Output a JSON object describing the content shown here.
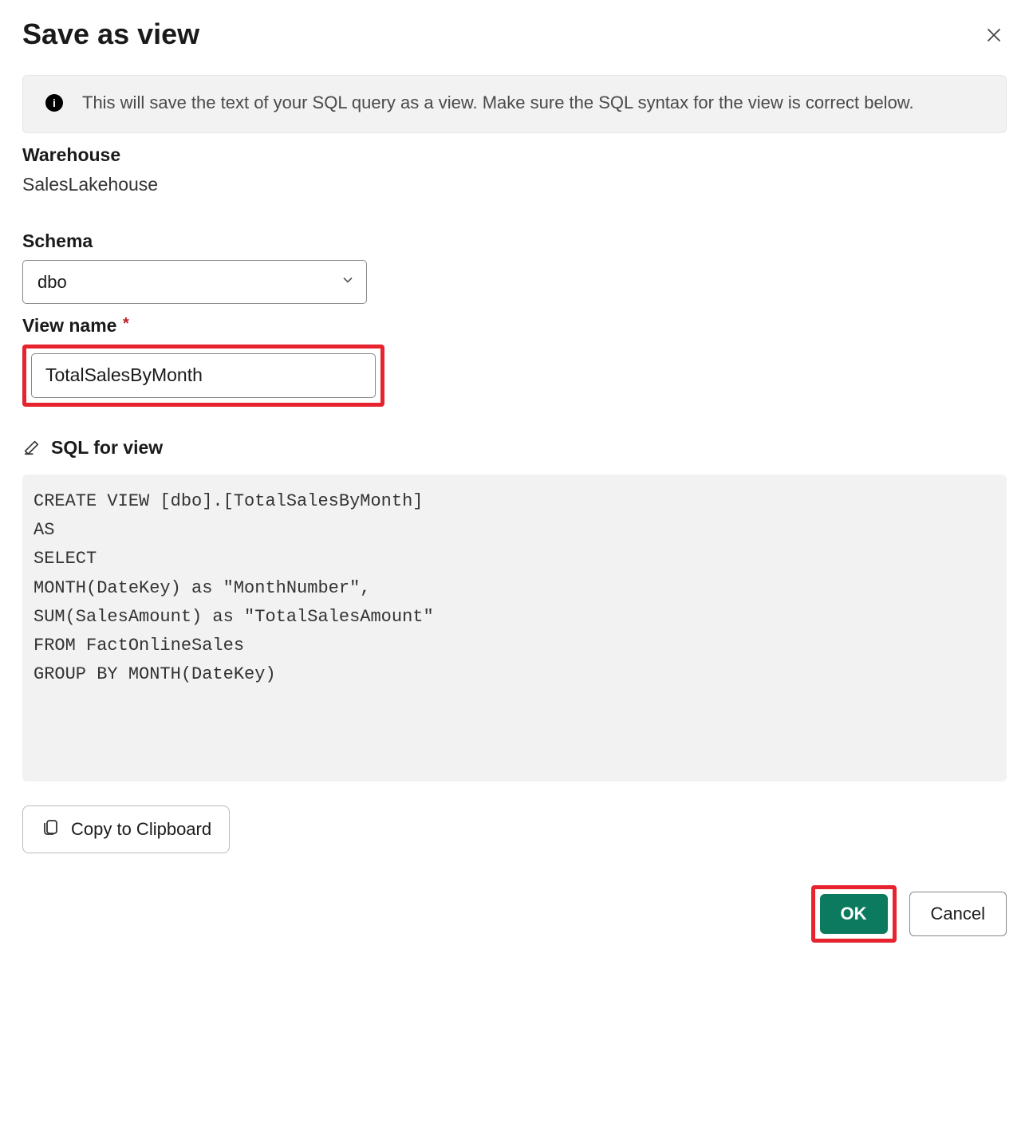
{
  "header": {
    "title": "Save as view"
  },
  "info": {
    "text": "This will save the text of your SQL query as a view. Make sure the SQL syntax for the view is correct below."
  },
  "warehouse": {
    "label": "Warehouse",
    "value": "SalesLakehouse"
  },
  "schema": {
    "label": "Schema",
    "value": "dbo"
  },
  "viewName": {
    "label": "View name",
    "value": "TotalSalesByMonth"
  },
  "sql": {
    "label": "SQL for view",
    "code": "CREATE VIEW [dbo].[TotalSalesByMonth]\nAS\nSELECT\nMONTH(DateKey) as \"MonthNumber\",\nSUM(SalesAmount) as \"TotalSalesAmount\"\nFROM FactOnlineSales\nGROUP BY MONTH(DateKey)"
  },
  "buttons": {
    "copy": "Copy to Clipboard",
    "ok": "OK",
    "cancel": "Cancel"
  }
}
